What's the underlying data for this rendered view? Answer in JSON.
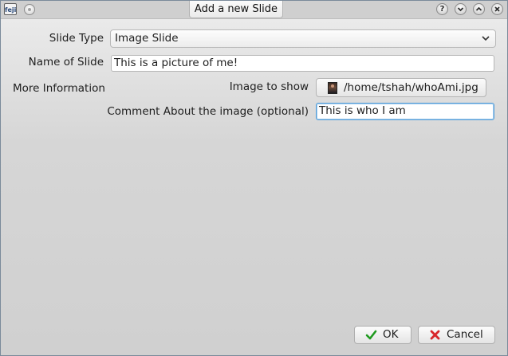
{
  "window": {
    "title": "Add a new Slide",
    "app_icon_text": "feji",
    "controls": [
      "help",
      "minimize",
      "maximize",
      "close"
    ]
  },
  "form": {
    "slide_type": {
      "label": "Slide Type",
      "selected": "Image Slide"
    },
    "name_of_slide": {
      "label": "Name of Slide",
      "value": "This is a picture of me!"
    },
    "more_information": {
      "label": "More Information",
      "image_to_show": {
        "label": "Image to show",
        "path": "/home/tshah/whoAmi.jpg"
      },
      "comment": {
        "label": "Comment About the image (optional)",
        "value": "This is who I am"
      }
    }
  },
  "buttons": {
    "ok": "OK",
    "cancel": "Cancel"
  },
  "icons": {
    "ok": "checkmark-icon",
    "cancel": "x-cross-icon",
    "file": "image-thumbnail-icon"
  },
  "colors": {
    "focus": "#5aa0d8",
    "ok_icon": "#1f9a1f",
    "cancel_icon": "#d8262b"
  }
}
